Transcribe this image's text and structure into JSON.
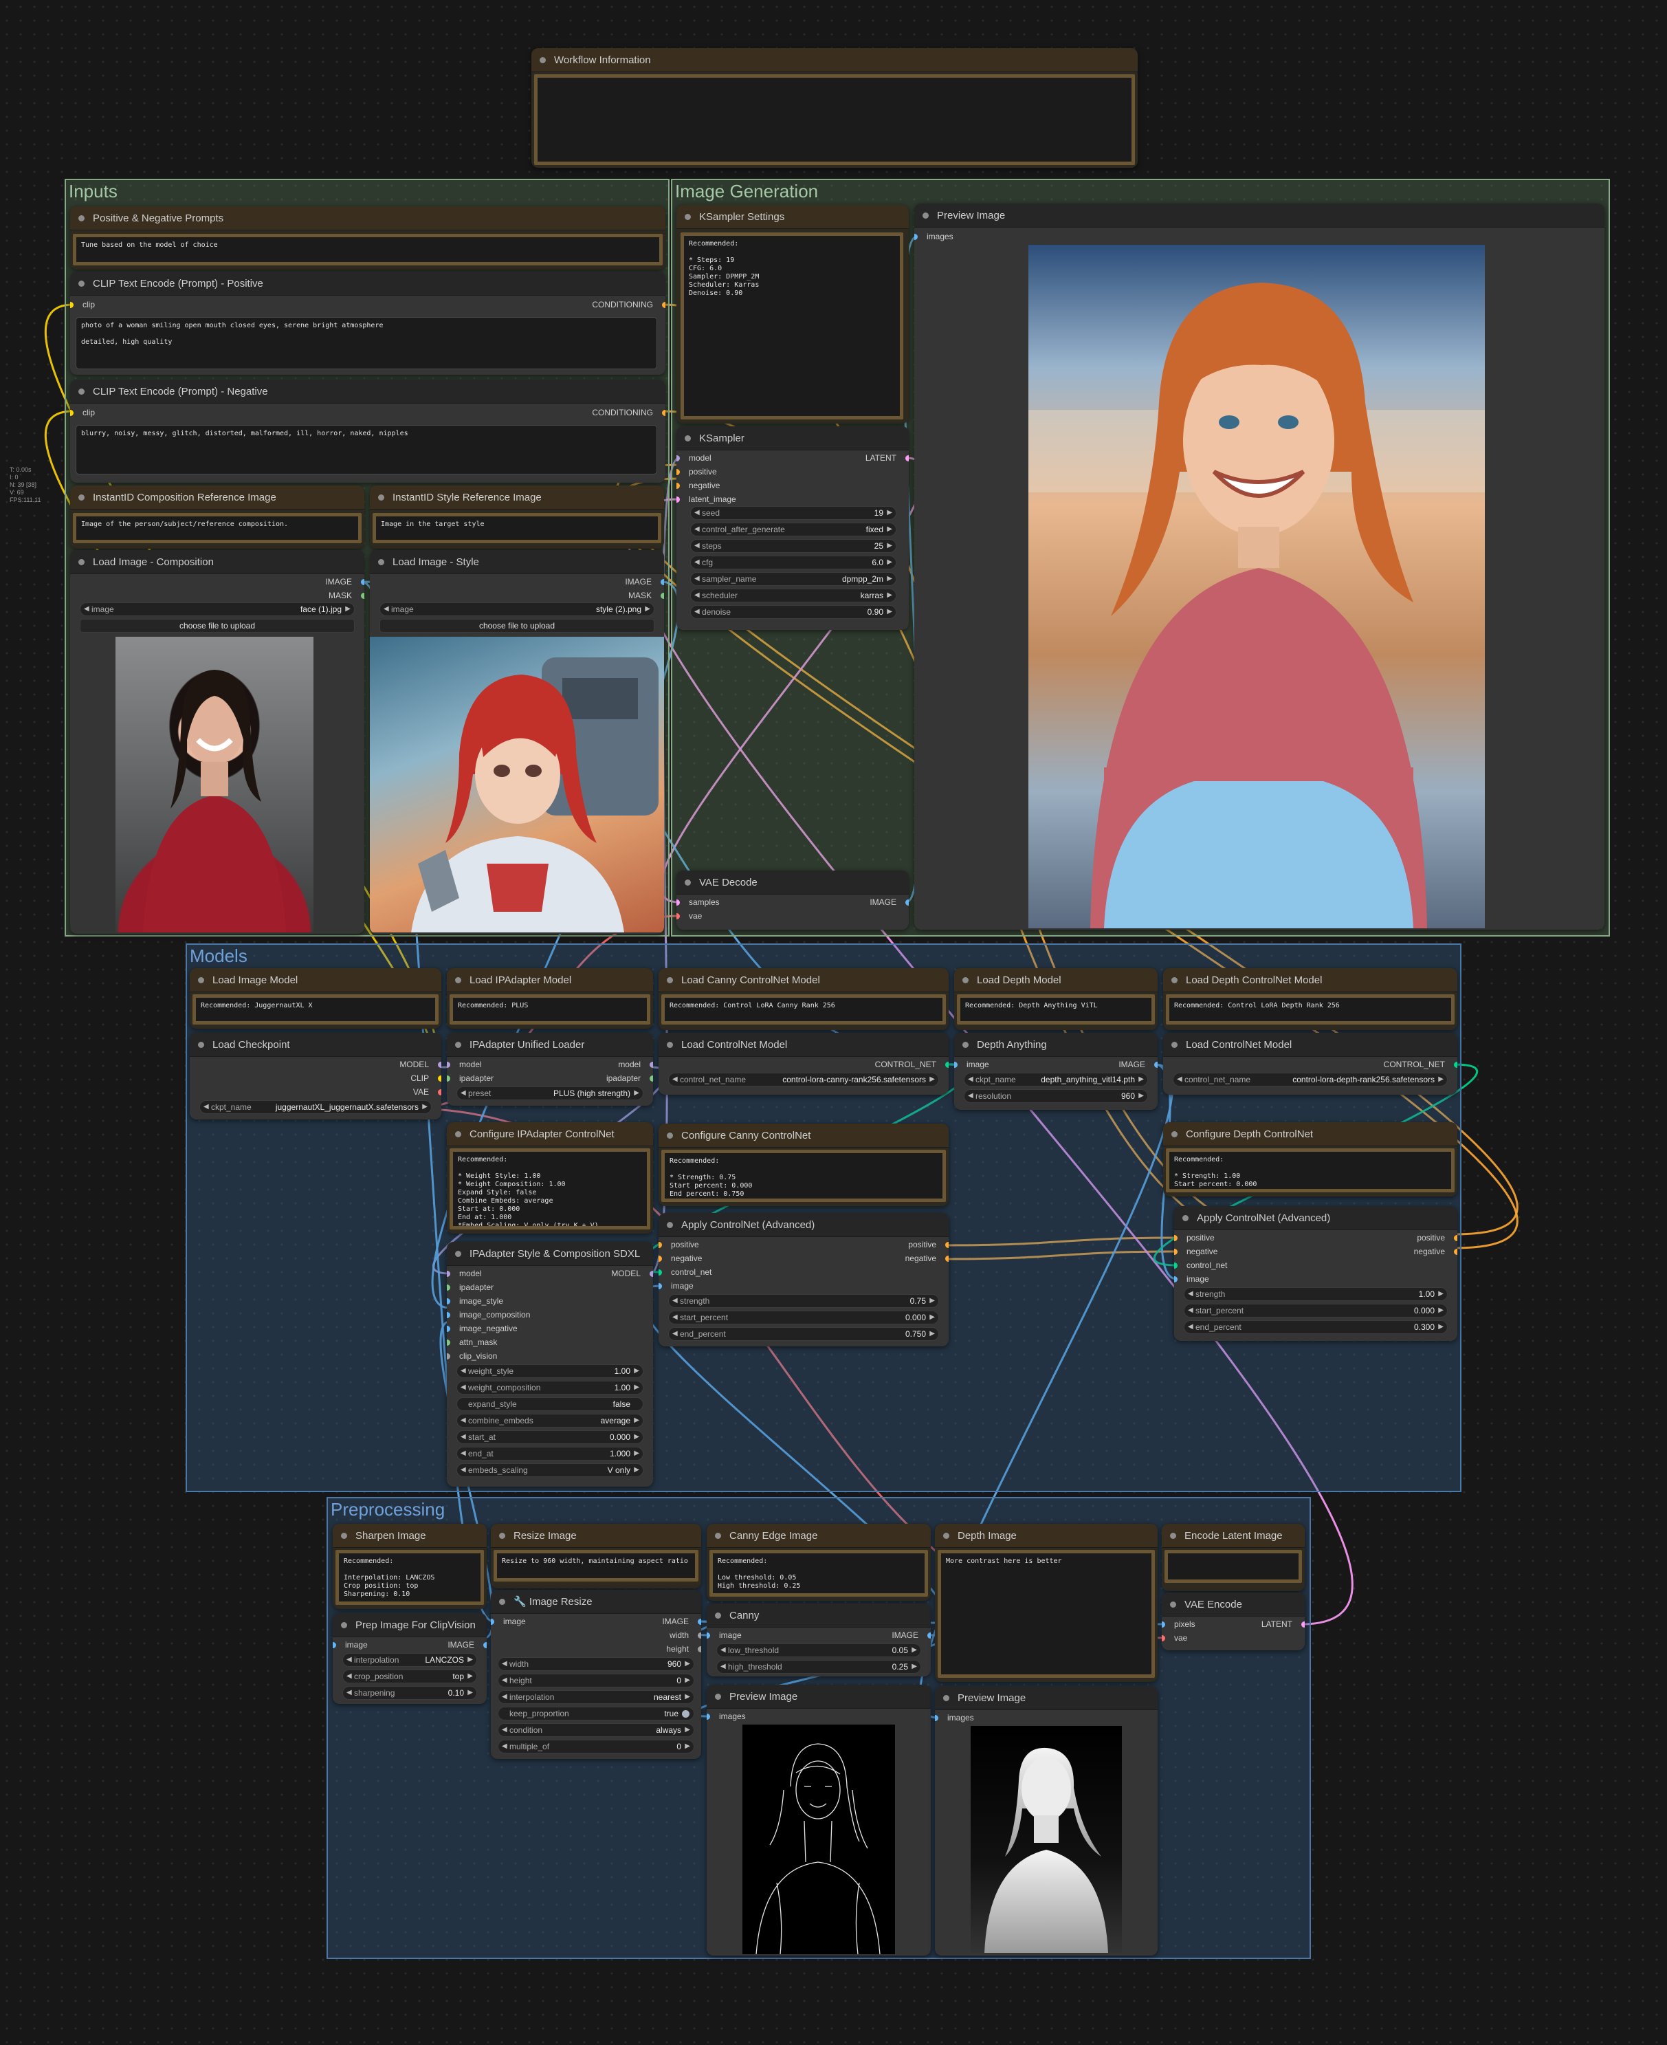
{
  "stats": {
    "lines": [
      "T: 0.00s",
      "I: 0",
      "N: 39 [38]",
      "V: 69",
      "FPS:111.11"
    ]
  },
  "colors": {
    "clip": "#ffd500",
    "conditioning": "#ffa931",
    "model": "#b39ddb",
    "latent": "#ff9cf9",
    "vae": "#ff6e6e",
    "image": "#64b5f6",
    "mask": "#81c784",
    "control_net": "#00d78d"
  },
  "groups": {
    "inputs": "Inputs",
    "image_generation": "Image Generation",
    "models": "Models",
    "preprocessing": "Preprocessing"
  },
  "nodes": {
    "workflow_info": {
      "title": "Workflow Information",
      "text": ""
    },
    "prompts_note": {
      "title": "Positive & Negative Prompts",
      "text": "Tune based on the model of choice"
    },
    "clip_pos": {
      "title": "CLIP Text Encode (Prompt) - Positive",
      "in": "clip",
      "out": "CONDITIONING",
      "text": "photo of a woman smiling open mouth closed eyes, serene bright atmosphere\n\ndetailed, high quality"
    },
    "clip_neg": {
      "title": "CLIP Text Encode (Prompt) - Negative",
      "in": "clip",
      "out": "CONDITIONING",
      "text": "blurry, noisy, messy, glitch, distorted, malformed, ill, horror, naked, nipples"
    },
    "comp_note": {
      "title": "InstantID Composition Reference Image",
      "text": "Image of the person/subject/reference composition."
    },
    "style_note": {
      "title": "InstantID Style Reference Image",
      "text": "Image in the target style"
    },
    "load_comp": {
      "title": "Load Image - Composition",
      "out1": "IMAGE",
      "out2": "MASK",
      "label": "image",
      "value": "face (1).jpg",
      "button": "choose file to upload"
    },
    "load_style": {
      "title": "Load Image - Style",
      "out1": "IMAGE",
      "out2": "MASK",
      "label": "image",
      "value": "style (2).png",
      "button": "choose file to upload"
    },
    "ksampler_note": {
      "title": "KSampler Settings",
      "text": "Recommended:\n\n* Steps: 19\nCFG: 6.0\nSampler: DPMPP_2M\nScheduler: Karras\nDenoise: 0.90"
    },
    "ksampler": {
      "title": "KSampler",
      "inputs": [
        "model",
        "positive",
        "negative",
        "latent_image"
      ],
      "out": "LATENT",
      "widgets": [
        {
          "label": "seed",
          "value": "19"
        },
        {
          "label": "control_after_generate",
          "value": "fixed"
        },
        {
          "label": "steps",
          "value": "25"
        },
        {
          "label": "cfg",
          "value": "6.0"
        },
        {
          "label": "sampler_name",
          "value": "dpmpp_2m"
        },
        {
          "label": "scheduler",
          "value": "karras"
        },
        {
          "label": "denoise",
          "value": "0.90"
        }
      ]
    },
    "vae_decode": {
      "title": "VAE Decode",
      "inputs": [
        "samples",
        "vae"
      ],
      "out": "IMAGE"
    },
    "preview_main": {
      "title": "Preview Image",
      "in": "images"
    },
    "load_image_model_note": {
      "title": "Load Image Model",
      "text": "Recommended: JuggernautXL X"
    },
    "load_checkpoint": {
      "title": "Load Checkpoint",
      "outs": [
        "MODEL",
        "CLIP",
        "VAE"
      ],
      "label": "ckpt_name",
      "value": "juggernautXL_juggernautX.safetensors"
    },
    "ipadapter_note": {
      "title": "Load IPAdapter Model",
      "text": "Recommended: PLUS"
    },
    "ipadapter_loader": {
      "title": "IPAdapter Unified Loader",
      "inputs": [
        "model",
        "ipadapter"
      ],
      "outs": [
        "model",
        "ipadapter"
      ],
      "label": "preset",
      "value": "PLUS (high strength)"
    },
    "cfg_ipadapter_note": {
      "title": "Configure IPAdapter ControlNet",
      "text": "Recommended:\n\n* Weight Style: 1.00\n* Weight Composition: 1.00\nExpand Style: false\nCombine Embeds: average\nStart at: 0.000\nEnd at: 1.000\n*Embed Scaling: V only (try K + V)"
    },
    "ipadapter_style": {
      "title": "IPAdapter Style & Composition SDXL",
      "inputs": [
        "model",
        "ipadapter",
        "image_style",
        "image_composition",
        "image_negative",
        "attn_mask",
        "clip_vision"
      ],
      "out": "MODEL",
      "widgets": [
        {
          "label": "weight_style",
          "value": "1.00"
        },
        {
          "label": "weight_composition",
          "value": "1.00"
        },
        {
          "label": "expand_style",
          "value": "false"
        },
        {
          "label": "combine_embeds",
          "value": "average"
        },
        {
          "label": "start_at",
          "value": "0.000"
        },
        {
          "label": "end_at",
          "value": "1.000"
        },
        {
          "label": "embeds_scaling",
          "value": "V only"
        }
      ]
    },
    "canny_cn_note": {
      "title": "Load Canny ControlNet Model",
      "text": "Recommended: Control LoRA Canny Rank 256"
    },
    "load_cn_canny": {
      "title": "Load ControlNet Model",
      "out": "CONTROL_NET",
      "label": "control_net_name",
      "value": "control-lora-canny-rank256.safetensors"
    },
    "cfg_canny_note": {
      "title": "Configure Canny ControlNet",
      "text": "Recommended:\n\n* Strength: 0.75\nStart percent: 0.000\nEnd percent: 0.750"
    },
    "apply_cn_canny": {
      "title": "Apply ControlNet (Advanced)",
      "inputs": [
        "positive",
        "negative",
        "control_net",
        "image"
      ],
      "outs": [
        "positive",
        "negative"
      ],
      "widgets": [
        {
          "label": "strength",
          "value": "0.75"
        },
        {
          "label": "start_percent",
          "value": "0.000"
        },
        {
          "label": "end_percent",
          "value": "0.750"
        }
      ]
    },
    "depth_model_note": {
      "title": "Load Depth Model",
      "text": "Recommended: Depth Anything ViTL"
    },
    "depth_anything": {
      "title": "Depth Anything",
      "in": "image",
      "out": "IMAGE",
      "widgets": [
        {
          "label": "ckpt_name",
          "value": "depth_anything_vitl14.pth"
        },
        {
          "label": "resolution",
          "value": "960"
        }
      ]
    },
    "depth_cn_note": {
      "title": "Load Depth ControlNet Model",
      "text": "Recommended: Control LoRA Depth Rank 256"
    },
    "load_cn_depth": {
      "title": "Load ControlNet Model",
      "out": "CONTROL_NET",
      "label": "control_net_name",
      "value": "control-lora-depth-rank256.safetensors"
    },
    "cfg_depth_note": {
      "title": "Configure Depth ControlNet",
      "text": "Recommended:\n\n* Strength: 1.00\nStart percent: 0.000\nEnd percent: 0.300"
    },
    "apply_cn_depth": {
      "title": "Apply ControlNet (Advanced)",
      "inputs": [
        "positive",
        "negative",
        "control_net",
        "image"
      ],
      "outs": [
        "positive",
        "negative"
      ],
      "widgets": [
        {
          "label": "strength",
          "value": "1.00"
        },
        {
          "label": "start_percent",
          "value": "0.000"
        },
        {
          "label": "end_percent",
          "value": "0.300"
        }
      ]
    },
    "sharpen_note": {
      "title": "Sharpen Image",
      "text": "Recommended:\n\nInterpolation: LANCZOS\nCrop position: top\nSharpening: 0.10"
    },
    "prep_clipvision": {
      "title": "Prep Image For ClipVision",
      "in": "image",
      "out": "IMAGE",
      "widgets": [
        {
          "label": "interpolation",
          "value": "LANCZOS"
        },
        {
          "label": "crop_position",
          "value": "top"
        },
        {
          "label": "sharpening",
          "value": "0.10"
        }
      ]
    },
    "resize_note": {
      "title": "Resize Image",
      "text": "Resize to 960 width, maintaining aspect ratio"
    },
    "image_resize": {
      "title": "🔧 Image Resize",
      "in": "image",
      "outs": [
        "IMAGE",
        "width",
        "height"
      ],
      "widgets": [
        {
          "label": "width",
          "value": "960"
        },
        {
          "label": "height",
          "value": "0"
        },
        {
          "label": "interpolation",
          "value": "nearest"
        },
        {
          "label": "keep_proportion",
          "value": "true"
        },
        {
          "label": "condition",
          "value": "always"
        },
        {
          "label": "multiple_of",
          "value": "0"
        }
      ]
    },
    "canny_note": {
      "title": "Canny Edge Image",
      "text": "Recommended:\n\nLow threshold: 0.05\nHigh threshold: 0.25"
    },
    "canny": {
      "title": "Canny",
      "in": "image",
      "out": "IMAGE",
      "widgets": [
        {
          "label": "low_threshold",
          "value": "0.05"
        },
        {
          "label": "high_threshold",
          "value": "0.25"
        }
      ]
    },
    "preview_canny": {
      "title": "Preview Image",
      "in": "images"
    },
    "depth_note": {
      "title": "Depth Image",
      "text": "More contrast here is better"
    },
    "preview_depth": {
      "title": "Preview Image",
      "in": "images"
    },
    "encode_latent_note": {
      "title": "Encode Latent Image",
      "text": ""
    },
    "vae_encode": {
      "title": "VAE Encode",
      "inputs": [
        "pixels",
        "vae"
      ],
      "out": "LATENT"
    }
  }
}
